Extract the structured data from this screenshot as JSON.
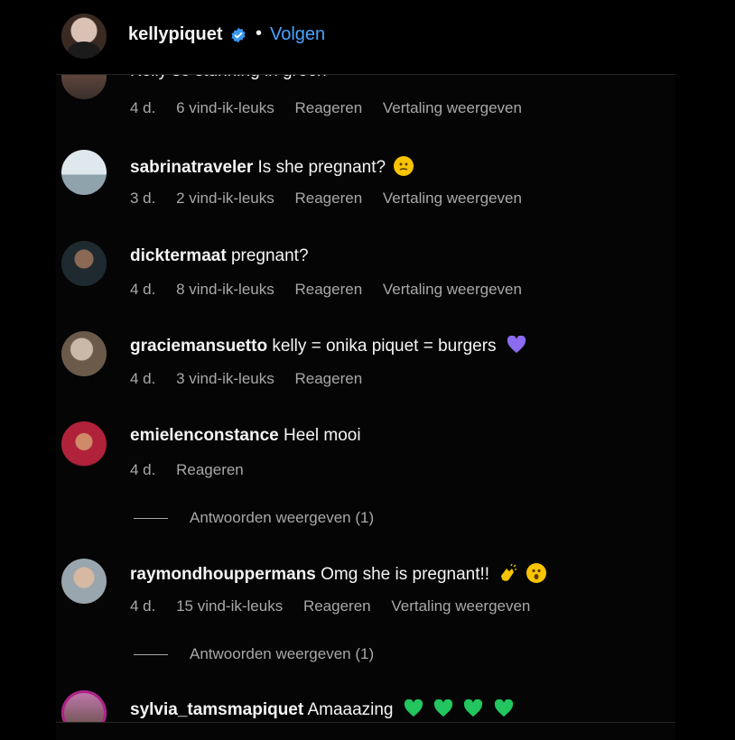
{
  "header": {
    "username": "kellypiquet",
    "separator": "•",
    "follow_label": "Volgen"
  },
  "comments": [
    {
      "username": "",
      "text": "Kelly so stunning in green",
      "time": "4 d.",
      "likes": "6 vind-ik-leuks",
      "reply": "Reageren",
      "translate": "Vertaling weergeven"
    },
    {
      "username": "sabrinatraveler",
      "text": "Is she pregnant?",
      "time": "3 d.",
      "likes": "2 vind-ik-leuks",
      "reply": "Reageren",
      "translate": "Vertaling weergeven"
    },
    {
      "username": "dicktermaat",
      "text": "pregnant?",
      "time": "4 d.",
      "likes": "8 vind-ik-leuks",
      "reply": "Reageren",
      "translate": "Vertaling weergeven"
    },
    {
      "username": "graciemansuetto",
      "text": "kelly = onika piquet = burgers",
      "time": "4 d.",
      "likes": "3 vind-ik-leuks",
      "reply": "Reageren"
    },
    {
      "username": "emielenconstance",
      "text": "Heel mooi",
      "time": "4 d.",
      "reply": "Reageren",
      "view_replies": "Antwoorden weergeven (1)"
    },
    {
      "username": "raymondhouppermans",
      "text": "Omg she is pregnant!!",
      "time": "4 d.",
      "likes": "15 vind-ik-leuks",
      "reply": "Reageren",
      "translate": "Vertaling weergeven",
      "view_replies": "Antwoorden weergeven (1)"
    },
    {
      "username": "sylvia_tamsmapiquet",
      "text": "Amaaazing"
    }
  ],
  "colors": {
    "link_blue": "#4aa3ff",
    "muted": "#a8a8a8",
    "heart_green": "#22c55e",
    "heart_purple": "#8b6cf0",
    "emoji_yellow": "#f7c400"
  },
  "icons": [
    "verified-badge-icon",
    "thinking-face-emoji",
    "purple-heart-emoji",
    "clapping-hands-emoji",
    "surprised-face-emoji",
    "green-heart-emoji"
  ]
}
